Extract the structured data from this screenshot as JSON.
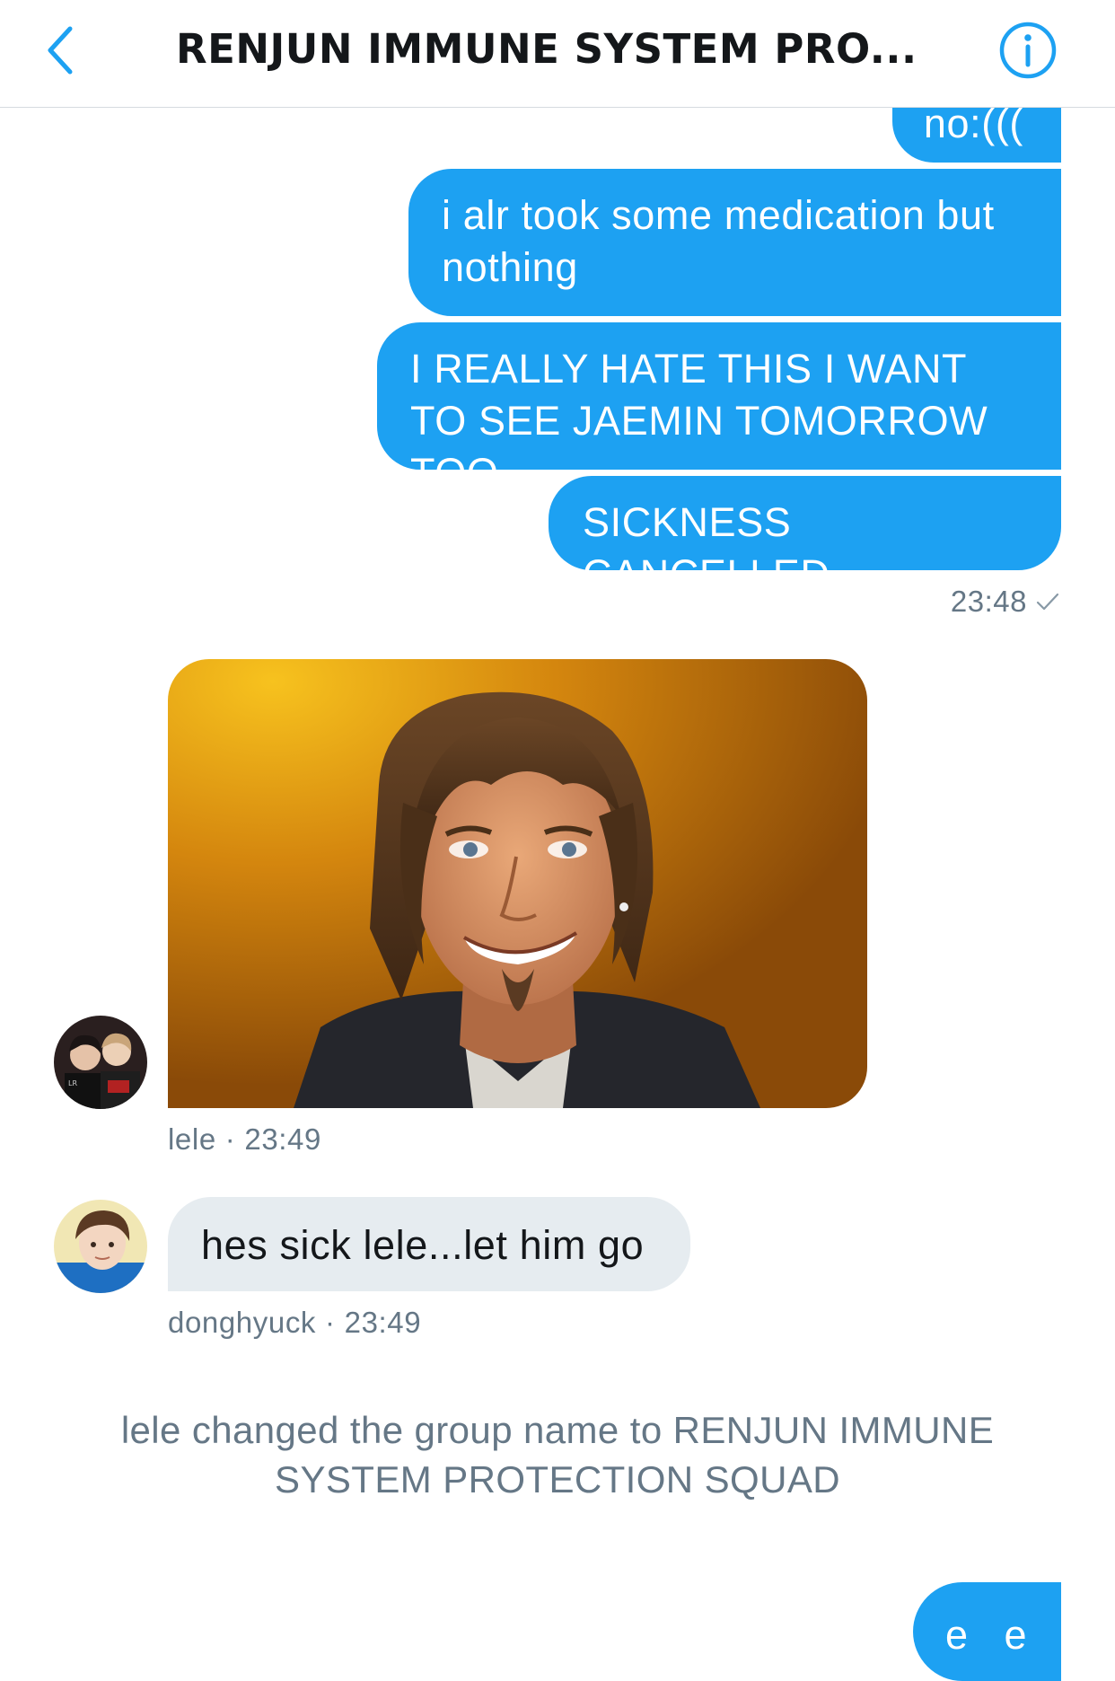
{
  "colors": {
    "accent": "#1da1f2",
    "incoming_bubble": "#e6ecf0",
    "meta_text": "#657786"
  },
  "header": {
    "back_icon": "chevron-left-icon",
    "title": "RENJUN IMMUNE SYSTEM PRO...",
    "info_icon": "info-circle-icon"
  },
  "messages": {
    "outgoing": [
      "no:(((",
      "i alr took some medication but nothing",
      "I REALLY HATE THIS I WANT TO SEE JAEMIN TOMORROW TOO",
      "SICKNESS CANCELLED"
    ],
    "outgoing_time": "23:48",
    "outgoing_status_icon": "checkmark-icon",
    "lele": {
      "name": "lele",
      "separator": "·",
      "time": "23:49",
      "attachment": "photo of smiling man with shoulder-length hair and goatee"
    },
    "donghyuck": {
      "name": "donghyuck",
      "separator": "·",
      "time": "23:49",
      "text": "hes sick lele...let him go"
    },
    "system": "lele changed the group name to RENJUN IMMUNE SYSTEM PROTECTION SQUAD",
    "last_outgoing_partial": "e e"
  }
}
